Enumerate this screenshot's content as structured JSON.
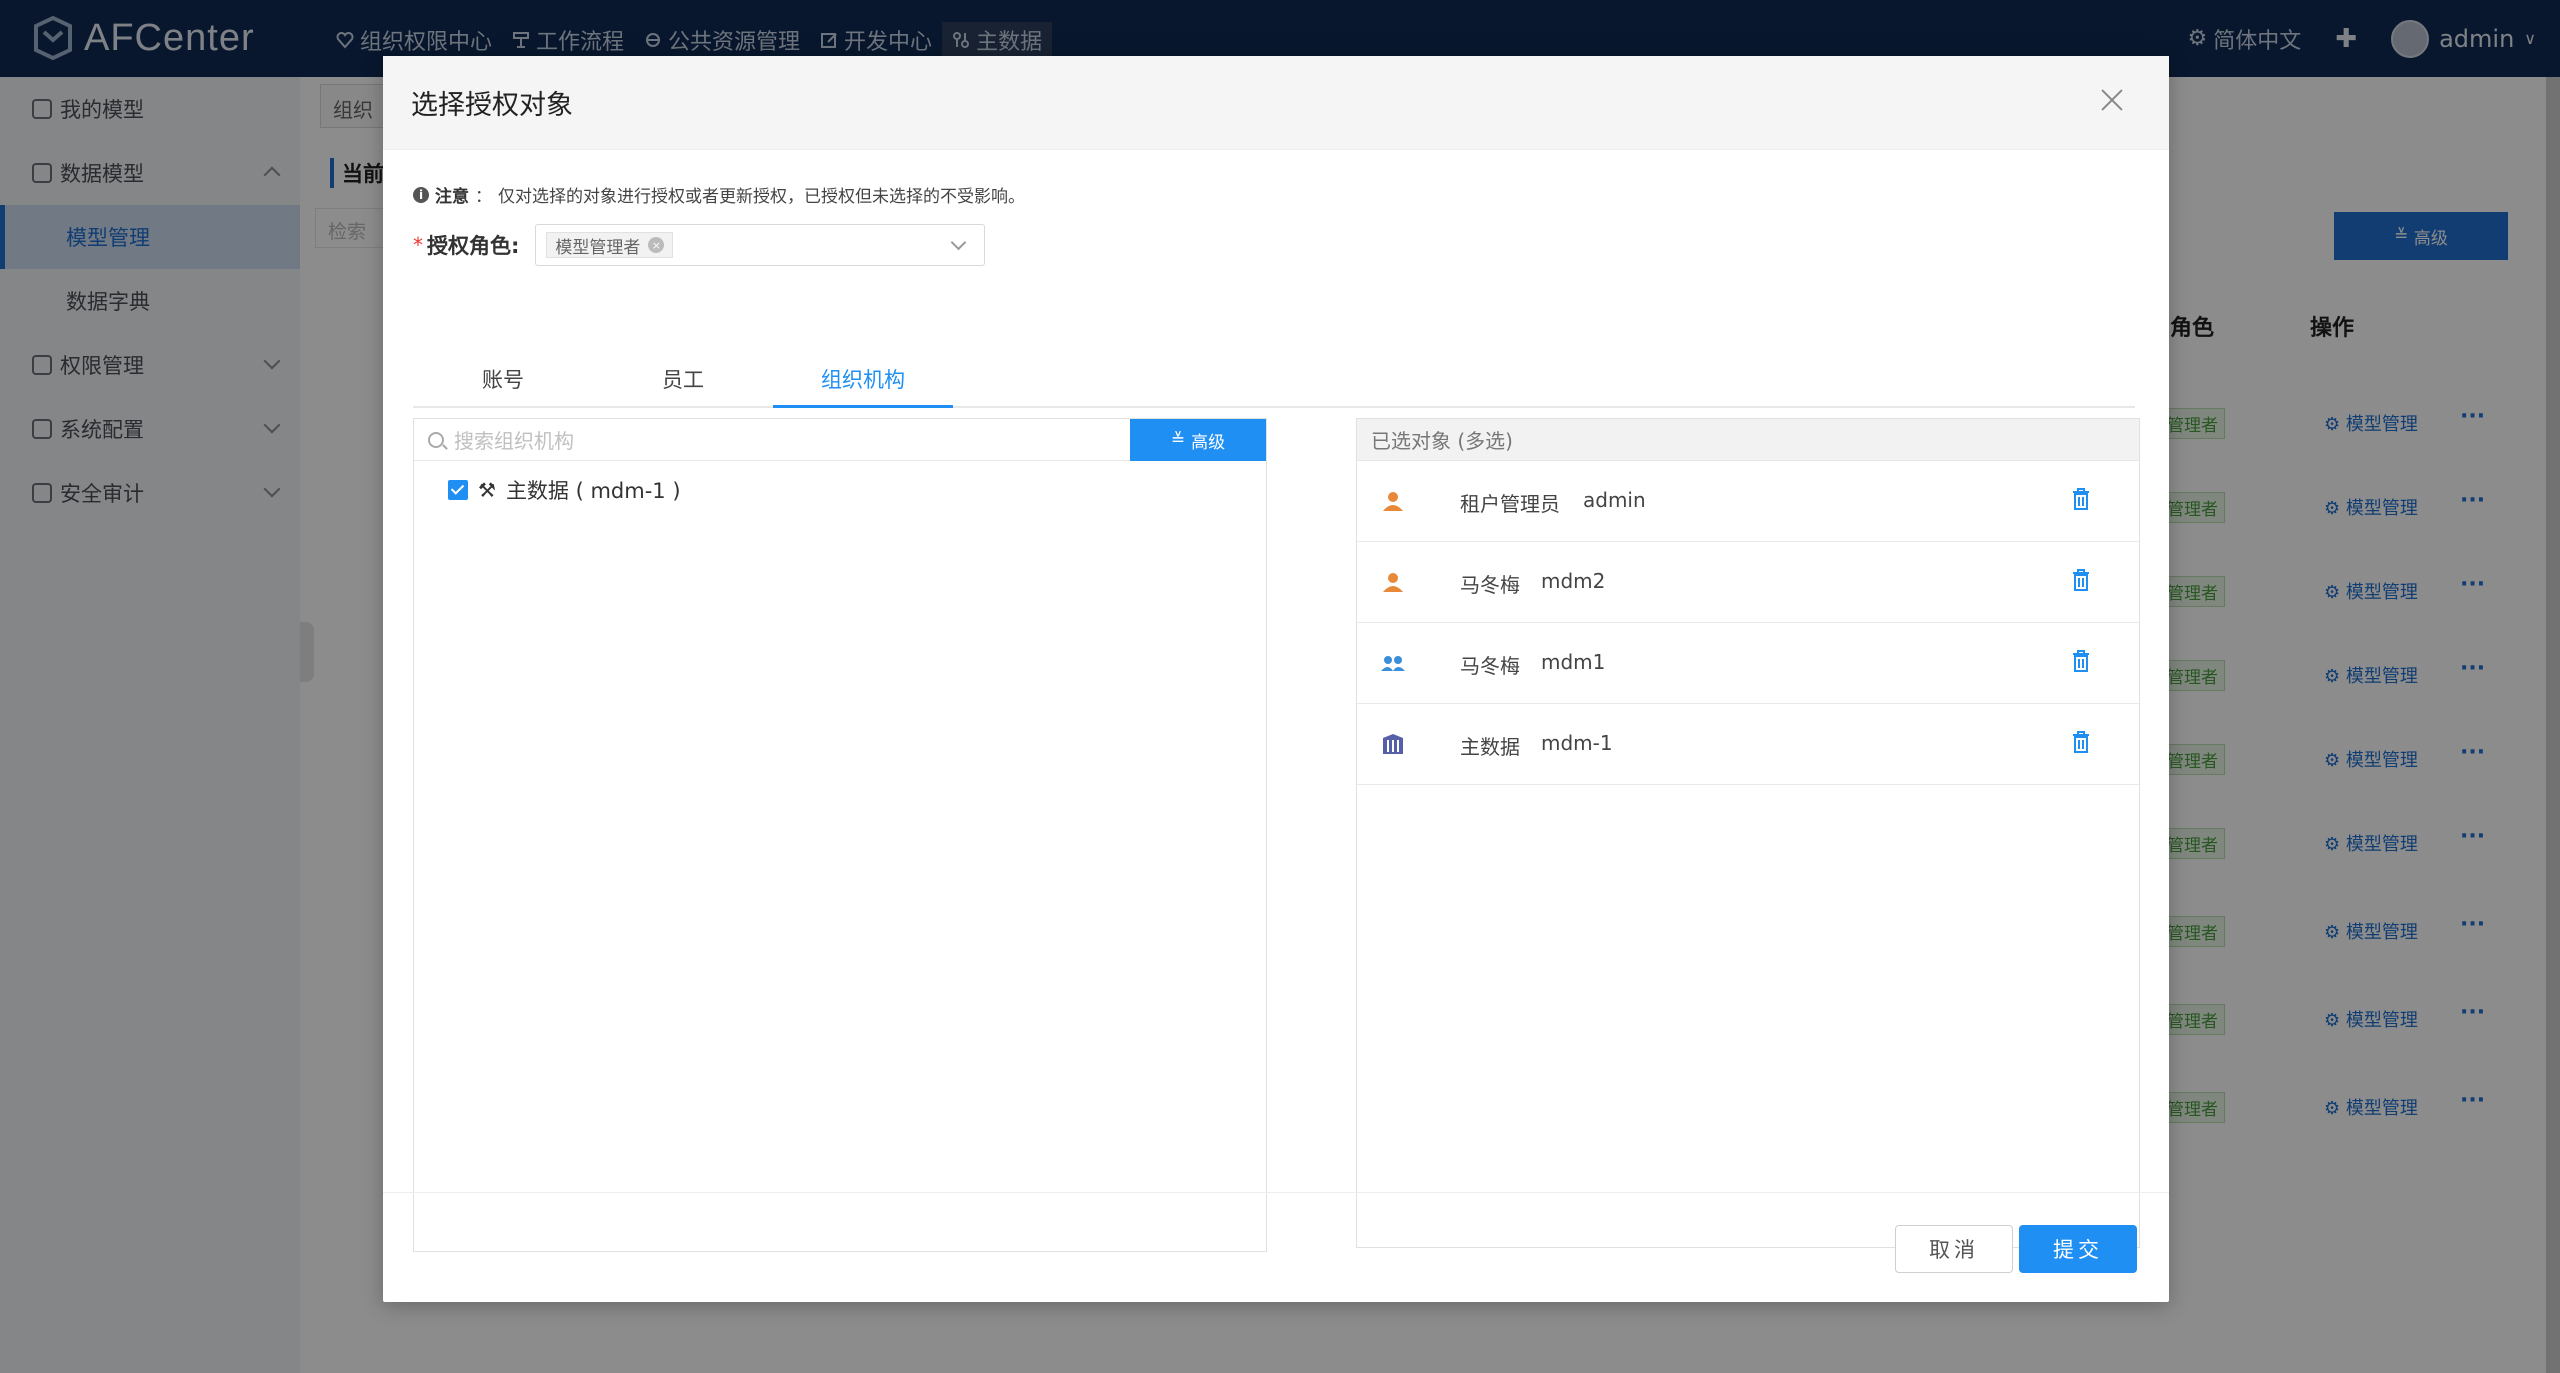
{
  "header": {
    "app_name": "AFCenter",
    "nav": [
      {
        "label": "组织权限中心",
        "icon": "heart-shield-icon"
      },
      {
        "label": "工作流程",
        "icon": "flow-icon"
      },
      {
        "label": "公共资源管理",
        "icon": "resource-icon"
      },
      {
        "label": "开发中心",
        "icon": "edit-icon"
      },
      {
        "label": "主数据",
        "icon": "masterdata-icon"
      }
    ],
    "language": "简体中文",
    "user": "admin"
  },
  "sidebar": {
    "items": [
      {
        "label": "我的模型"
      },
      {
        "label": "数据模型"
      },
      {
        "label": "模型管理"
      },
      {
        "label": "数据字典"
      },
      {
        "label": "权限管理"
      },
      {
        "label": "系统配置"
      },
      {
        "label": "安全审计"
      }
    ]
  },
  "background": {
    "tab": "组织",
    "current": "当前",
    "search_placeholder": "检索",
    "advanced": "高级",
    "col_role": "角色",
    "col_op": "操作",
    "role_tag": "管理者",
    "manage_link": "模型管理",
    "more": "···"
  },
  "modal": {
    "title": "选择授权对象",
    "notice_label": "注意",
    "notice_text": "仅对选择的对象进行授权或者更新授权，已授权但未选择的不受影响。",
    "role_label": "授权角色:",
    "role_value": "模型管理者",
    "tabs": [
      {
        "label": "账号"
      },
      {
        "label": "员工"
      },
      {
        "label": "组织机构"
      }
    ],
    "search_placeholder": "搜索组织机构",
    "advanced_label": "高级",
    "tree_node": "主数据 ( mdm-1 )",
    "selected_header": "已选对象 (多选)",
    "selected": [
      {
        "name": "租户管理员",
        "code": "admin",
        "icon": "user-icon",
        "color": "#e8893a"
      },
      {
        "name": "马冬梅",
        "code": "mdm2",
        "icon": "user-icon",
        "color": "#e8893a"
      },
      {
        "name": "马冬梅",
        "code": "mdm1",
        "icon": "employee-icon",
        "color": "#3a8fd8"
      },
      {
        "name": "主数据",
        "code": "mdm-1",
        "icon": "organization-icon",
        "color": "#5560a8"
      }
    ],
    "cancel_label": "取消",
    "submit_label": "提交"
  },
  "colors": {
    "header_bg": "#0f2a52",
    "primary": "#1f8ff3"
  }
}
